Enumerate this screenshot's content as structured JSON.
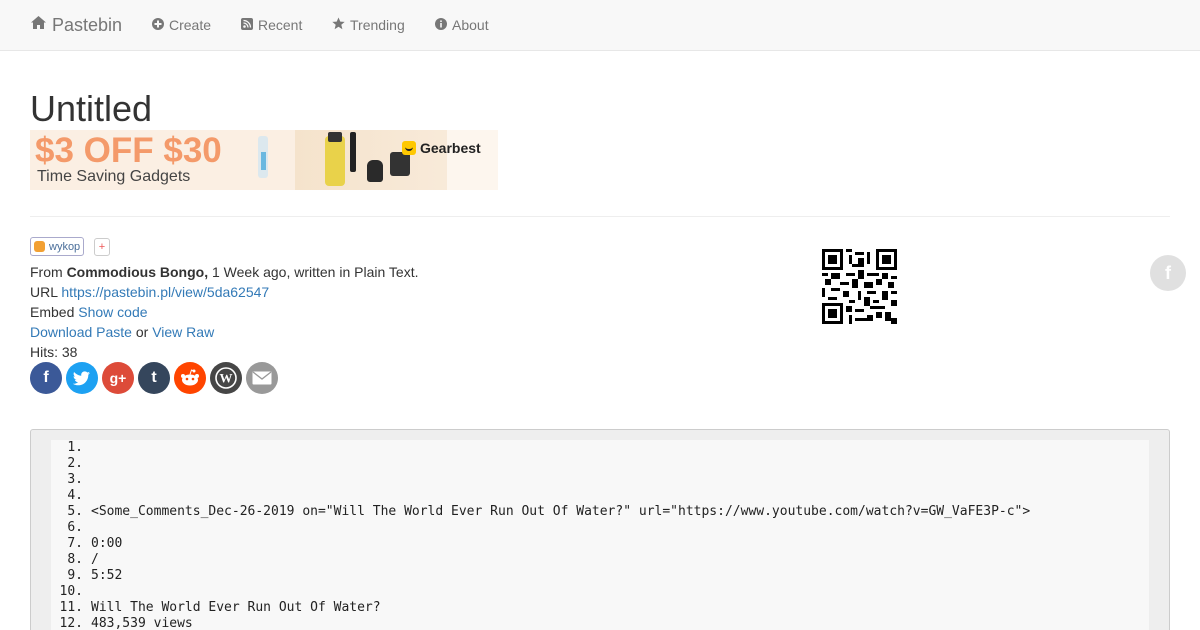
{
  "nav": {
    "brand": "Pastebin",
    "items": [
      {
        "label": "Create",
        "icon": "plus-circle-icon"
      },
      {
        "label": "Recent",
        "icon": "rss-icon"
      },
      {
        "label": "Trending",
        "icon": "star-icon"
      },
      {
        "label": "About",
        "icon": "info-circle-icon"
      }
    ]
  },
  "page": {
    "title": "Untitled"
  },
  "banner": {
    "price": "$3 OFF $30",
    "subtitle": "Time Saving Gadgets",
    "logo": "Gearbest"
  },
  "share": {
    "wykop": "wykop",
    "plus": "+"
  },
  "meta": {
    "from_label": "From",
    "author": "Commodious Bongo,",
    "time_text": "1 Week ago, written in Plain Text.",
    "url_label": "URL",
    "url": "https://pastebin.pl/view/5da62547",
    "embed_label": "Embed",
    "embed_link": "Show code",
    "download": "Download Paste",
    "or": "or",
    "raw": "View Raw",
    "hits": "Hits: 38"
  },
  "socials": [
    {
      "name": "facebook",
      "glyph": "f",
      "color": "#3b5998"
    },
    {
      "name": "twitter",
      "glyph": "t",
      "color": "#1da1f2"
    },
    {
      "name": "google-plus",
      "glyph": "g+",
      "color": "#dd4b39"
    },
    {
      "name": "tumblr",
      "glyph": "t",
      "color": "#35465c"
    },
    {
      "name": "reddit",
      "glyph": "r",
      "color": "#ff4500"
    },
    {
      "name": "wordpress",
      "glyph": "W",
      "color": "#464646"
    },
    {
      "name": "email",
      "glyph": "✉",
      "color": "#999999"
    }
  ],
  "float_fb": "f",
  "code_lines": [
    {
      "n": "1.",
      "t": ""
    },
    {
      "n": "2.",
      "t": ""
    },
    {
      "n": "3.",
      "t": ""
    },
    {
      "n": "4.",
      "t": ""
    },
    {
      "n": "5.",
      "t": "<Some_Comments_Dec-26-2019 on=\"Will The World Ever Run Out Of Water?\" url=\"https://www.youtube.com/watch?v=GW_VaFE3P-c\">"
    },
    {
      "n": "6.",
      "t": ""
    },
    {
      "n": "7.",
      "t": "0:00"
    },
    {
      "n": "8.",
      "t": "/"
    },
    {
      "n": "9.",
      "t": "5:52"
    },
    {
      "n": "10.",
      "t": ""
    },
    {
      "n": "11.",
      "t": "Will The World Ever Run Out Of Water?"
    },
    {
      "n": "12.",
      "t": "483,539 views"
    }
  ]
}
